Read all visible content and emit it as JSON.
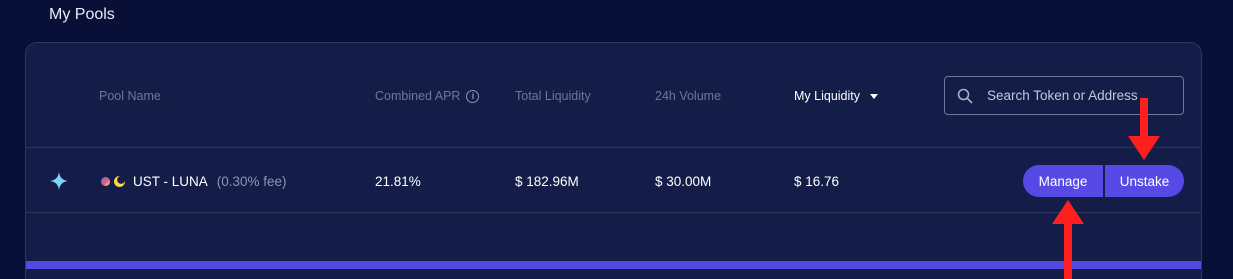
{
  "section": {
    "title": "My Pools"
  },
  "table": {
    "headers": {
      "pool_name": "Pool Name",
      "combined_apr": "Combined APR",
      "total_liquidity": "Total Liquidity",
      "volume_24h": "24h Volume",
      "my_liquidity": "My Liquidity"
    },
    "search": {
      "placeholder": "Search Token or Address",
      "value": ""
    },
    "rows": [
      {
        "pool_name": "UST - LUNA",
        "fee": "(0.30% fee)",
        "combined_apr": "21.81%",
        "total_liquidity": "$ 182.96M",
        "volume_24h": "$ 30.00M",
        "my_liquidity": "$ 16.76",
        "actions": {
          "manage": "Manage",
          "unstake": "Unstake"
        }
      }
    ]
  },
  "icons": {
    "info": "info-icon",
    "search": "search-icon",
    "sort": "caret-down-icon",
    "favorite": "sparkle-icon",
    "token_a": "ust-token-icon",
    "token_b": "luna-token-icon"
  },
  "colors": {
    "background": "#081038",
    "panel": "#141d48",
    "accent": "#5649e6",
    "annotation_arrow": "#ff1f1f"
  }
}
